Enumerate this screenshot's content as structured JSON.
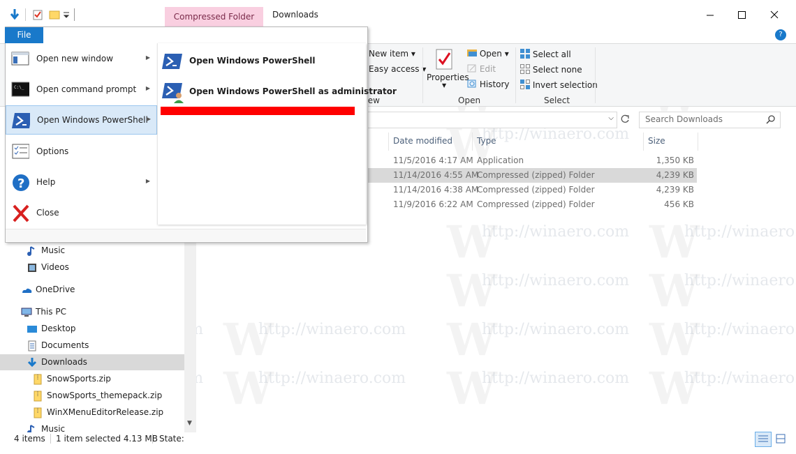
{
  "titlebar": {
    "context_tab": "Compressed Folder Tools",
    "title": "Downloads",
    "colors": {
      "context_tab_bg": "#f9cfe0",
      "accent": "#1979ca"
    }
  },
  "ribbon": {
    "file_tab": "File",
    "new_group": {
      "items": [
        "New item",
        "Easy access"
      ],
      "label": "New"
    },
    "open_group": {
      "properties": "Properties",
      "items": [
        "Open",
        "Edit",
        "History"
      ],
      "label": "Open"
    },
    "select_group": {
      "items": [
        "Select all",
        "Select none",
        "Invert selection"
      ],
      "label": "Select"
    }
  },
  "search": {
    "placeholder": "Search Downloads"
  },
  "columns": [
    "Date modified",
    "Type",
    "Size"
  ],
  "files": [
    {
      "date": "11/5/2016 4:17 AM",
      "type": "Application",
      "size": "1,350 KB",
      "selected": false
    },
    {
      "date": "11/14/2016 4:55 AM",
      "type": "Compressed (zipped) Folder",
      "size": "4,239 KB",
      "selected": true
    },
    {
      "date": "11/14/2016 4:38 AM",
      "type": "Compressed (zipped) Folder",
      "size": "4,239 KB",
      "selected": false
    },
    {
      "date": "11/9/2016 6:22 AM",
      "type": "Compressed (zipped) Folder",
      "size": "456 KB",
      "selected": false
    }
  ],
  "nav": {
    "items": [
      {
        "label": "Music",
        "icon": "music-icon"
      },
      {
        "label": "Videos",
        "icon": "videos-icon"
      },
      {
        "label": "OneDrive",
        "icon": "onedrive-icon"
      },
      {
        "label": "This PC",
        "icon": "pc-icon"
      },
      {
        "label": "Desktop",
        "icon": "desktop-icon"
      },
      {
        "label": "Documents",
        "icon": "documents-icon"
      },
      {
        "label": "Downloads",
        "icon": "downloads-icon"
      },
      {
        "label": "SnowSports.zip",
        "icon": "zip-icon"
      },
      {
        "label": "SnowSports_themepack.zip",
        "icon": "zip-icon"
      },
      {
        "label": "WinXMenuEditorRelease.zip",
        "icon": "zip-icon"
      },
      {
        "label": "Music",
        "icon": "music-icon"
      }
    ]
  },
  "status": {
    "items": "4 items",
    "selected": "1 item selected  4.13 MB",
    "state": "State:"
  },
  "file_menu": {
    "items": [
      {
        "label": "Open new window",
        "has_arrow": true,
        "selected": false
      },
      {
        "label": "Open command prompt",
        "has_arrow": true,
        "selected": false
      },
      {
        "label": "Open Windows PowerShell",
        "has_arrow": true,
        "selected": true
      },
      {
        "label": "Options",
        "has_arrow": false,
        "selected": false
      },
      {
        "label": "Help",
        "has_arrow": true,
        "selected": false
      },
      {
        "label": "Close",
        "has_arrow": false,
        "selected": false
      }
    ],
    "submenu": [
      "Open Windows PowerShell",
      "Open Windows PowerShell as administrator"
    ],
    "highlight_color": "#ff0000"
  },
  "watermark": "http://winaero.com"
}
